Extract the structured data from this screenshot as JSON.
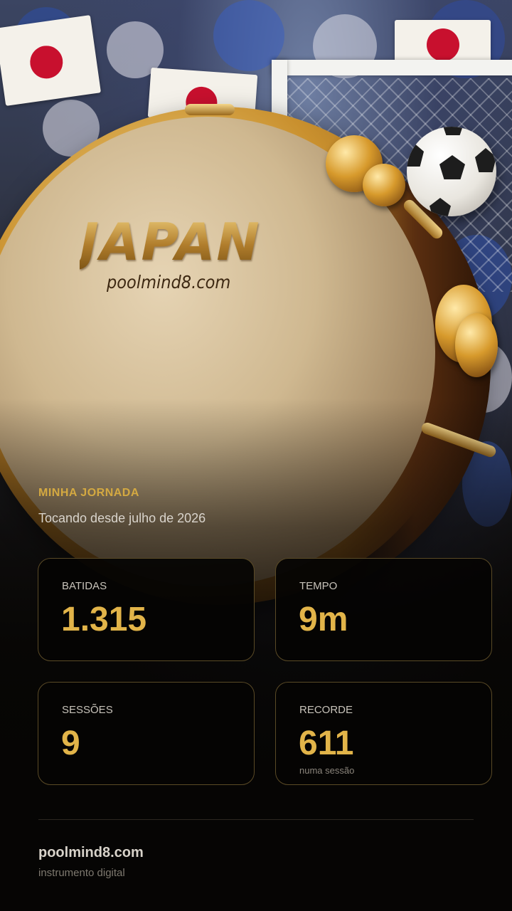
{
  "hero": {
    "drum_title": "JAPAN",
    "drum_domain": "poolmind8.com"
  },
  "journey": {
    "section_label": "MINHA JORNADA",
    "since_text": "Tocando desde julho de 2026"
  },
  "stats": [
    {
      "label": "BATIDAS",
      "value": "1.315",
      "sub": ""
    },
    {
      "label": "TEMPO",
      "value": "9m",
      "sub": ""
    },
    {
      "label": "SESSÕES",
      "value": "9",
      "sub": ""
    },
    {
      "label": "RECORDE",
      "value": "611",
      "sub": "numa sessão"
    }
  ],
  "footer": {
    "brand": "poolmind8.com",
    "subtitle": "instrumento digital"
  },
  "colors": {
    "accent_gold": "#e2b449",
    "label_gold": "#d4a941",
    "background": "#060504",
    "card_border": "#5a4a26"
  }
}
